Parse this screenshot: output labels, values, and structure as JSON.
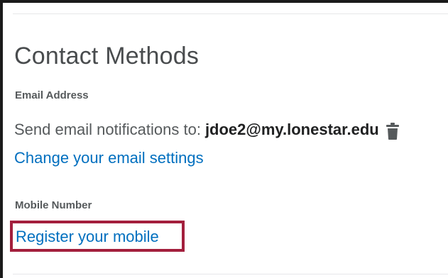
{
  "contact_methods": {
    "title": "Contact Methods",
    "email": {
      "label": "Email Address",
      "prefix": "Send email notifications to:",
      "address": "jdoe2@my.lonestar.edu",
      "delete_icon": "trash-icon",
      "change_link": "Change your email settings"
    },
    "mobile": {
      "label": "Mobile Number",
      "register_link": "Register your mobile"
    }
  },
  "colors": {
    "link": "#006fbf",
    "heading": "#494c4e",
    "label": "#565a5c",
    "highlight": "#a31f3d"
  }
}
